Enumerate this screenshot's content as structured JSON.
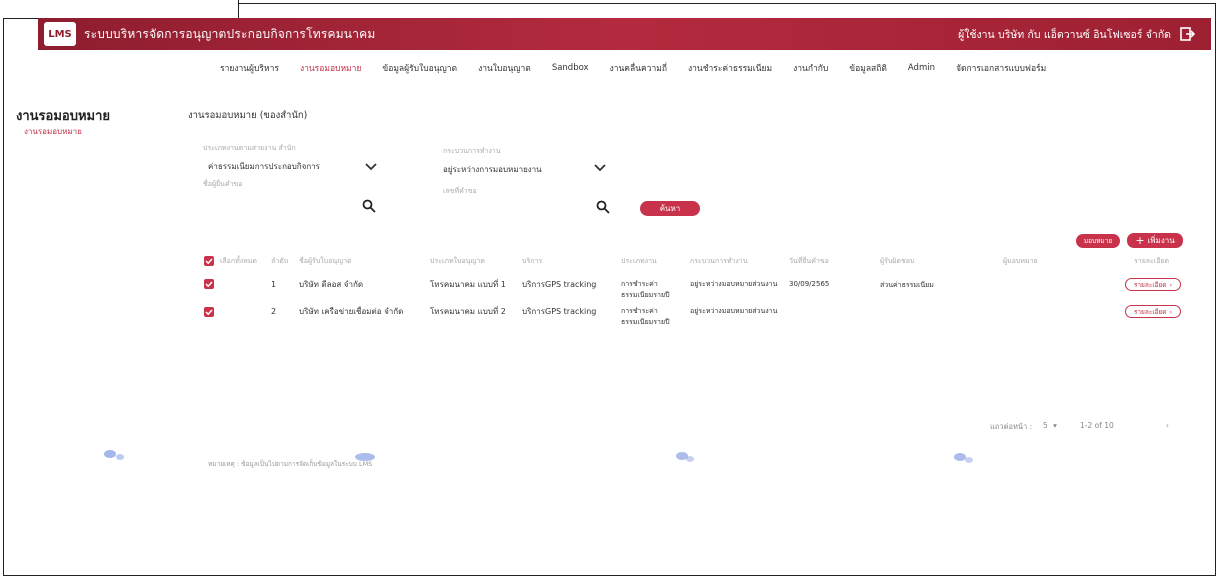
{
  "header": {
    "logo_text": "LMS",
    "app_title": "ระบบบริหารจัดการอนุญาตประกอบกิจการโทรคมนาคม",
    "user_label": "ผู้ใช้งาน บริษัท กับ แอ็ดวานซ์ อินโฟเซอร์ จำกัด"
  },
  "nav": {
    "items": [
      {
        "label": "รายงานผู้บริหาร",
        "active": false
      },
      {
        "label": "งานรอมอบหมาย",
        "active": true
      },
      {
        "label": "ข้อมูลผู้รับใบอนุญาต",
        "active": false
      },
      {
        "label": "งานใบอนุญาต",
        "active": false
      },
      {
        "label": "Sandbox",
        "active": false
      },
      {
        "label": "งานคลื่นความถี่",
        "active": false
      },
      {
        "label": "งานชำระค่าธรรมเนียม",
        "active": false
      },
      {
        "label": "งานกำกับ",
        "active": false
      },
      {
        "label": "ข้อมูลสถิติ",
        "active": false
      },
      {
        "label": "Admin",
        "active": false
      },
      {
        "label": "จัดการเอกสารแบบฟอร์ม",
        "active": false
      }
    ]
  },
  "sidebar": {
    "title": "งานรอมอบหมาย",
    "subitem": "งานรอมอบหมาย"
  },
  "main": {
    "page_title": "งานรอมอบหมาย (ของสำนัก)",
    "filters": {
      "task_type_label": "ประเภทงานตามสายงาน สำนัก",
      "task_type_value": "ค่าธรรมเนียมการประกอบกิจการ",
      "process_label": "กระบวนการทำงาน",
      "process_value": "อยู่ระหว่างการมอบหมายงาน",
      "licensee_label": "ชื่อผู้ยื่นคำขอ",
      "request_label": "เลขที่คำขอ",
      "search_button": "ค้นหา"
    },
    "actions": {
      "export_button": "มอบหมาย",
      "add_button": "เพิ่มงาน"
    },
    "table": {
      "headers": [
        "เลือกทั้งหมด",
        "ลำดับ",
        "ชื่อผู้รับใบอนุญาต",
        "ประเภทใบอนุญาต",
        "บริการ",
        "ประเภทงาน",
        "กระบวนการทำงาน",
        "วันที่ยื่นคำขอ",
        "ผู้รับผิดชอบ",
        "ผู้มอบหมาย",
        "รายละเอียด"
      ],
      "rows": [
        {
          "no": "1",
          "licensee": "บริษัท ดีลอส จำกัด",
          "license_type": "โทรคมนาคม แบบที่ 1",
          "service": "บริการGPS tracking",
          "task_type": "การชำระค่าธรรมเนียมรายปี",
          "process": "อยู่ระหว่างมอบหมายส่วนงาน",
          "date": "30/09/2565",
          "assignee": "ส่วนค่าธรรมเนียม",
          "detail": "รายละเอียด"
        },
        {
          "no": "2",
          "licensee": "บริษัท เครือข่ายเชื่อมต่อ จำกัด",
          "license_type": "โทรคมนาคม แบบที่ 2",
          "service": "บริการGPS tracking",
          "task_type": "การชำระค่าธรรมเนียมรายปี",
          "process": "อยู่ระหว่างมอบหมายส่วนงาน",
          "date": "",
          "assignee": "",
          "detail": "รายละเอียด"
        }
      ]
    },
    "pager": {
      "rows_label": "แถวต่อหน้า :",
      "rows_value": "5",
      "range": "1-2 of 10"
    },
    "footer_note": "หมายเหตุ : ข้อมูลเป็นไปตามการจัดเก็บข้อมูลในระบบ LMS"
  },
  "colors": {
    "brand": "#b42a3e",
    "accent": "#c8334b"
  }
}
